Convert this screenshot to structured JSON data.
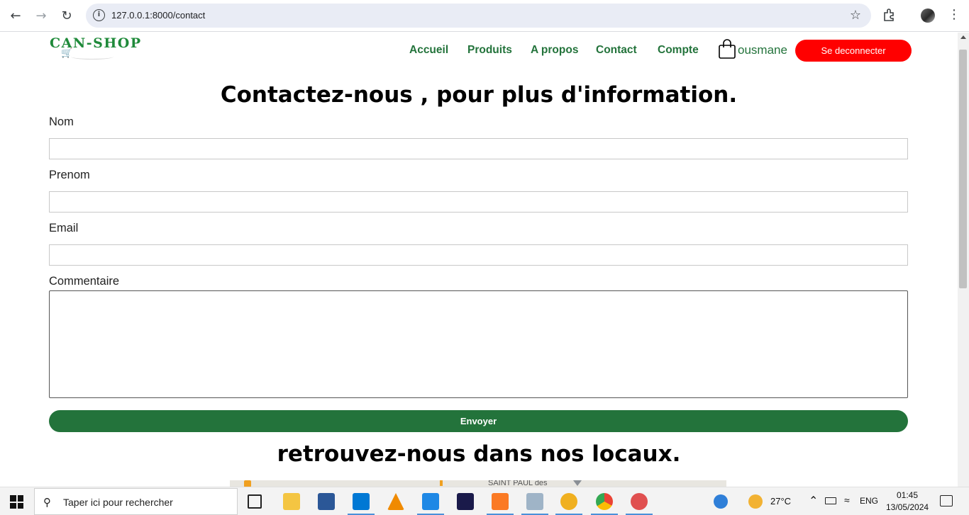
{
  "browser": {
    "url": "127.0.0.1:8000/contact"
  },
  "site": {
    "logo_text": "CAN-SHOP",
    "nav": [
      {
        "label": "Accueil"
      },
      {
        "label": "Produits"
      },
      {
        "label": "A propos"
      },
      {
        "label": "Contact"
      },
      {
        "label": "Compte"
      }
    ],
    "username": "ousmane",
    "logout_label": "Se deconnecter"
  },
  "contact": {
    "title": "Contactez-nous , pour plus d'information.",
    "fields": {
      "nom_label": "Nom",
      "prenom_label": "Prenom",
      "email_label": "Email",
      "commentaire_label": "Commentaire"
    },
    "submit_label": "Envoyer",
    "locations_title": "retrouvez-nous dans nos locaux.",
    "map_label": "SAINT PAUL des"
  },
  "taskbar": {
    "search_placeholder": "Taper ici pour rechercher",
    "apps": [
      "task-view",
      "file-explorer",
      "word",
      "vscode",
      "vlc",
      "virtualbox",
      "visual-studio",
      "xampp",
      "image-viewer",
      "pgadmin",
      "chrome",
      "paint"
    ],
    "weather": "27°C",
    "language": "ENG",
    "time": "01:45",
    "date": "13/05/2024"
  },
  "colors": {
    "brand_green": "#23733b",
    "logout_red": "#ff0000"
  }
}
